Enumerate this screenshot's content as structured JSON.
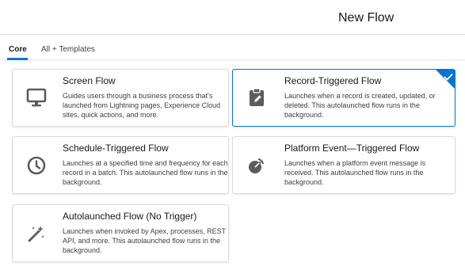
{
  "header": {
    "title": "New Flow"
  },
  "tabs": [
    {
      "label": "Core",
      "active": true
    },
    {
      "label": "All + Templates",
      "active": false
    }
  ],
  "cards": [
    {
      "title": "Screen Flow",
      "description": "Guides users through a business process that's launched from Lightning pages, Experience Cloud sites, quick actions, and more.",
      "icon": "desktop-monitor-icon",
      "selected": false
    },
    {
      "title": "Record-Triggered Flow",
      "description": "Launches when a record is created, updated, or deleted. This autolaunched flow runs in the background.",
      "icon": "clipboard-record-icon",
      "selected": true
    },
    {
      "title": "Schedule-Triggered Flow",
      "description": "Launches at a specified time and frequency for each record in a batch. This autolaunched flow runs in the background.",
      "icon": "clock-icon",
      "selected": false
    },
    {
      "title": "Platform Event—Triggered Flow",
      "description": "Launches when a platform event message is received. This autolaunched flow runs in the background.",
      "icon": "platform-event-icon",
      "selected": false
    },
    {
      "title": "Autolaunched Flow (No Trigger)",
      "description": "Launches when invoked by Apex, processes, REST API, and more. This autolaunched flow runs in the background.",
      "icon": "magic-wand-icon",
      "selected": false
    }
  ],
  "colors": {
    "accent": "#0176d3",
    "icon": "#5c5c5c"
  }
}
